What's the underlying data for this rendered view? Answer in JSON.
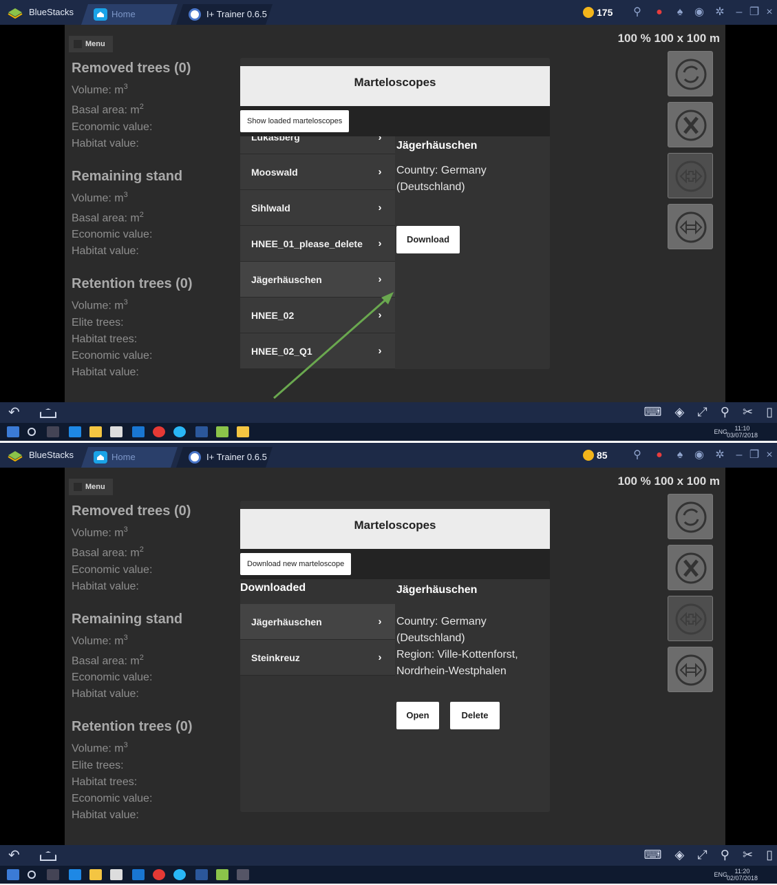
{
  "screens": [
    {
      "window": {
        "app_tab": "BlueStacks",
        "home_tab": "Home",
        "trainer_tab": "I+ Trainer 0.6.5",
        "coins": "175"
      },
      "menu_label": "Menu",
      "scale": "100 % 100 x 100 m",
      "stats": {
        "removed_title": "Removed trees (0)",
        "volume": "Volume: m",
        "basal": "Basal area: m",
        "economic": "Economic value:",
        "habitat": "Habitat value:",
        "remaining_title": "Remaining stand",
        "retention_title": "Retention trees (0)",
        "elite": "Elite trees:",
        "habitat_trees": "Habitat trees:"
      },
      "dialog": {
        "title": "Marteloscopes",
        "bar_button": "Show loaded marteloscopes",
        "list": [
          "Lukasberg",
          "Mooswald",
          "Sihlwald",
          "HNEE_01_please_delete",
          "Jägerhäuschen",
          "HNEE_02",
          "HNEE_02_Q1"
        ],
        "detail_title": "Jägerhäuschen",
        "detail_country": "Country: Germany (Deutschland)",
        "download_button": "Download"
      },
      "taskbar": {
        "time": "11:10",
        "date": "03/07/2018",
        "lang": "ENG"
      }
    },
    {
      "window": {
        "app_tab": "BlueStacks",
        "home_tab": "Home",
        "trainer_tab": "I+ Trainer 0.6.5",
        "coins": "85"
      },
      "menu_label": "Menu",
      "scale": "100 % 100 x 100 m",
      "stats": {
        "removed_title": "Removed trees (0)",
        "volume": "Volume: m",
        "basal": "Basal area: m",
        "economic": "Economic value:",
        "habitat": "Habitat value:",
        "remaining_title": "Remaining stand",
        "retention_title": "Retention trees (0)",
        "elite": "Elite trees:",
        "habitat_trees": "Habitat trees:"
      },
      "dialog": {
        "title": "Marteloscopes",
        "bar_button": "Download new marteloscope",
        "list_header": "Downloaded",
        "list": [
          "Jägerhäuschen",
          "Steinkreuz"
        ],
        "detail_title": "Jägerhäuschen",
        "detail_country": "Country: Germany (Deutschland)",
        "detail_region": "Region: Ville-Kottenforst, Nordrhein-Westphalen",
        "open_button": "Open",
        "delete_button": "Delete"
      },
      "taskbar": {
        "time": "11:20",
        "date": "02/07/2018",
        "lang": "ENG"
      }
    }
  ],
  "annotation_arrow_color": "#6aa84f"
}
